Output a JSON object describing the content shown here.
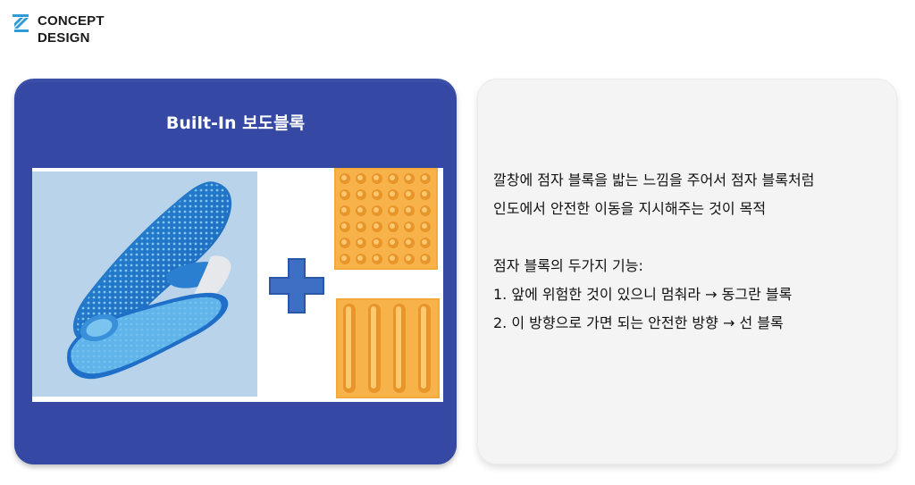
{
  "logo": {
    "line1": "CONCEPT",
    "line2": "DESIGN",
    "icon": "diagonal-stripes-icon",
    "color": "#2f9ad8"
  },
  "left_card": {
    "title": "Built-In 보도블록",
    "background": "#3448a4",
    "images": [
      "insole-image",
      "plus-icon",
      "dot-tactile-block-image",
      "line-tactile-block-image"
    ]
  },
  "right_card": {
    "lines": [
      "깔창에 점자 블록을 밟는 느낌을 주어서 점자 블록처럼",
      "인도에서 안전한 이동을 지시해주는 것이 목적",
      "",
      "점자 블록의 두가지 기능:",
      "1. 앞에 위험한 것이 있으니 멈춰라 → 동그란 블록",
      "2. 이 방향으로 가면 되는 안전한 방향 → 선 블록"
    ]
  }
}
